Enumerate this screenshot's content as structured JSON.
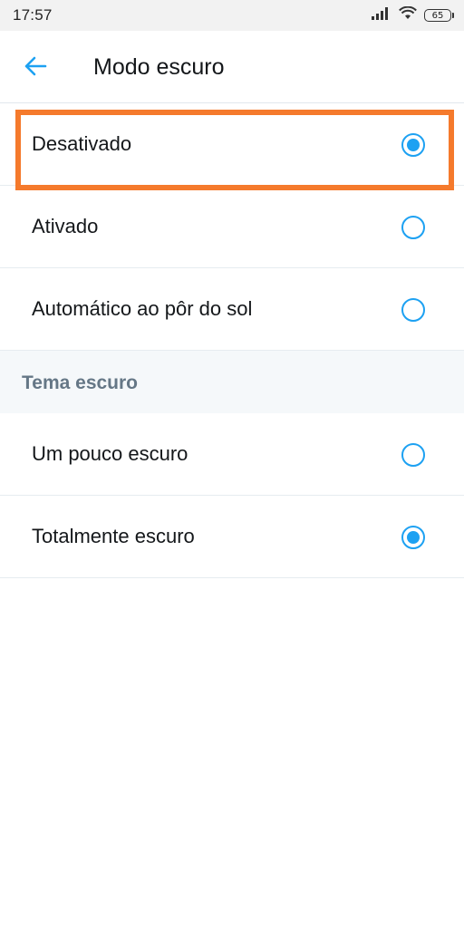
{
  "status_bar": {
    "time": "17:57",
    "battery": "65",
    "icons": [
      "signal-icon",
      "wifi-icon",
      "battery-icon"
    ]
  },
  "header": {
    "title": "Modo escuro",
    "back_icon": "back-arrow-icon"
  },
  "mode_options": [
    {
      "label": "Desativado",
      "selected": true
    },
    {
      "label": "Ativado",
      "selected": false
    },
    {
      "label": "Automático ao pôr do sol",
      "selected": false
    }
  ],
  "theme_section": {
    "title": "Tema escuro",
    "options": [
      {
        "label": "Um pouco escuro",
        "selected": false
      },
      {
        "label": "Totalmente escuro",
        "selected": true
      }
    ]
  },
  "colors": {
    "accent": "#1da1f2",
    "highlight": "#f57a2c",
    "section_bg": "#f5f8fa",
    "section_text": "#657786"
  }
}
